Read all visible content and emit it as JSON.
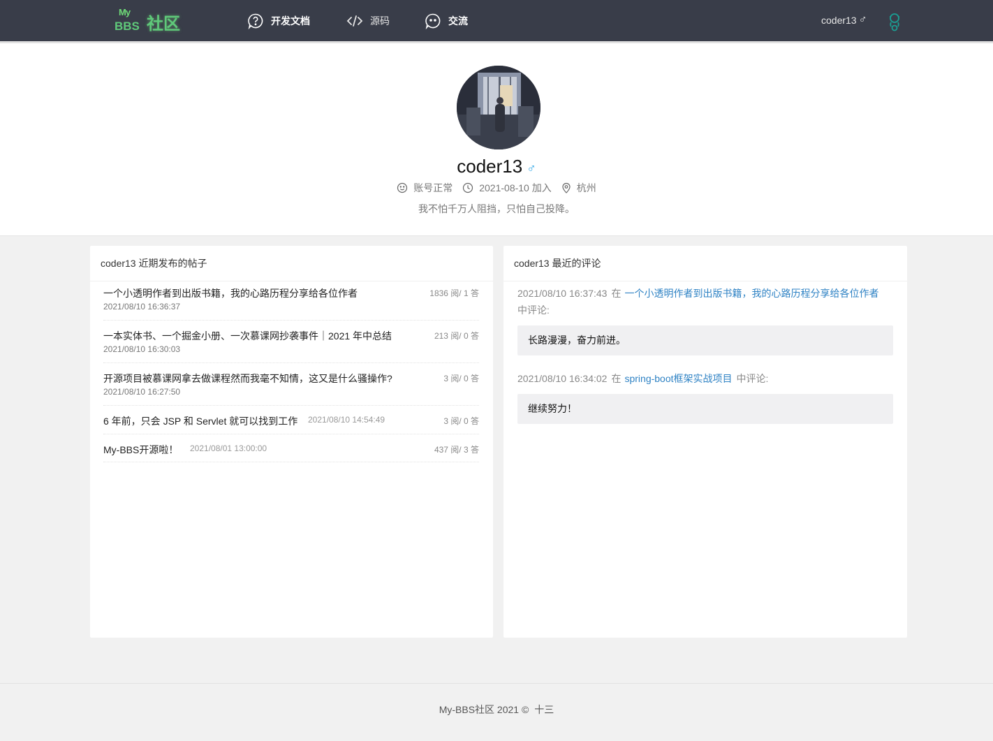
{
  "header": {
    "logo_my": "My",
    "logo_bbs": "BBS",
    "logo_cn": "社区",
    "nav": [
      {
        "label": "开发文档",
        "icon": "question-bubble-icon"
      },
      {
        "label": "源码",
        "icon": "code-icon"
      },
      {
        "label": "交流",
        "icon": "chat-icon"
      }
    ],
    "username": "coder13",
    "gender_symbol": "♂",
    "avatar_icon": "user-avatar-icon"
  },
  "profile": {
    "name": "coder13",
    "gender_symbol": "♂",
    "status": "账号正常",
    "joined": "2021-08-10 加入",
    "location": "杭州",
    "signature": "我不怕千万人阻挡，只怕自己投降。",
    "colors": {
      "gender": "#30a7e6"
    }
  },
  "posts_panel": {
    "title": "coder13 近期发布的帖子",
    "posts": [
      {
        "title": "一个小透明作者到出版书籍，我的心路历程分享给各位作者",
        "date": "2021/08/10 16:36:37",
        "stat": "1836 阅/ 1 答"
      },
      {
        "title": "一本实体书、一个掘金小册、一次慕课网抄袭事件｜2021 年中总结",
        "date": "2021/08/10 16:30:03",
        "stat": "213 阅/ 0 答"
      },
      {
        "title": "开源项目被慕课网拿去做课程然而我毫不知情，这又是什么骚操作?",
        "date": "2021/08/10 16:27:50",
        "stat": "3 阅/ 0 答"
      },
      {
        "title": "6 年前，只会 JSP 和 Servlet 就可以找到工作",
        "date": "2021/08/10 14:54:49",
        "stat": "3 阅/ 0 答"
      },
      {
        "title": "My-BBS开源啦！",
        "date": "2021/08/01 13:00:00",
        "stat": "437 阅/ 3 答"
      }
    ]
  },
  "comments_panel": {
    "title": "coder13 最近的评论",
    "in_word": "在",
    "suffix": "中评论:",
    "comments": [
      {
        "time": "2021/08/10 16:37:43",
        "post": "一个小透明作者到出版书籍，我的心路历程分享给各位作者",
        "content": "长路漫漫，奋力前进。"
      },
      {
        "time": "2021/08/10 16:34:02",
        "post": "spring-boot框架实战项目",
        "content": "继续努力！"
      }
    ],
    "colors": {
      "link": "#2e82c4"
    }
  },
  "footer": {
    "text": "My-BBS社区 2021 ©",
    "author": "十三"
  }
}
